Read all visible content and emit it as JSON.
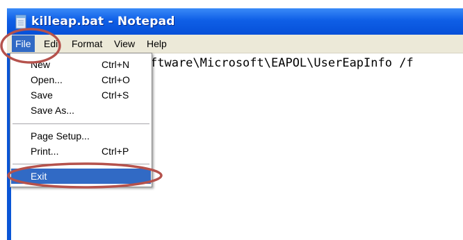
{
  "window": {
    "title": "killeap.bat - Notepad",
    "icon": "notepad-icon"
  },
  "menubar": {
    "items": [
      {
        "label": "File",
        "active": true
      },
      {
        "label": "Edit"
      },
      {
        "label": "Format"
      },
      {
        "label": "View"
      },
      {
        "label": "Help"
      }
    ]
  },
  "editor": {
    "visible_text": "ftware\\Microsoft\\EAPOL\\UserEapInfo /f"
  },
  "file_menu": {
    "items": [
      {
        "label": "New",
        "shortcut": "Ctrl+N"
      },
      {
        "label": "Open...",
        "shortcut": "Ctrl+O"
      },
      {
        "label": "Save",
        "shortcut": "Ctrl+S"
      },
      {
        "label": "Save As...",
        "shortcut": ""
      },
      {
        "label": "Page Setup...",
        "shortcut": ""
      },
      {
        "label": "Print...",
        "shortcut": "Ctrl+P"
      },
      {
        "label": "Exit",
        "shortcut": "",
        "highlighted": true
      }
    ]
  },
  "annotations": {
    "circle_color": "#b5524c"
  },
  "colors": {
    "titlebar": "#0650d8",
    "menu_highlight": "#316ac5",
    "menubar_bg": "#ece9d8"
  }
}
